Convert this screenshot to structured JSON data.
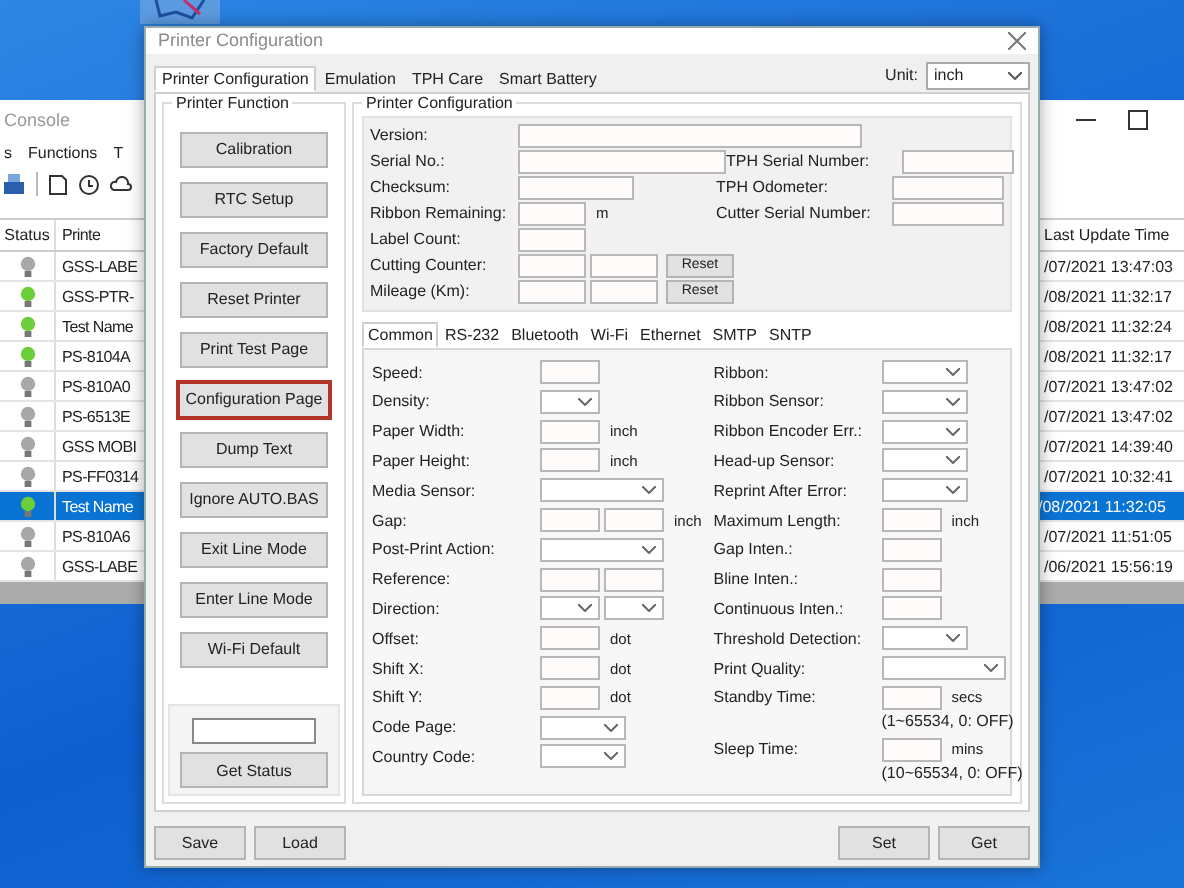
{
  "console": {
    "title": "Console",
    "menu": [
      "s",
      "Functions",
      "T"
    ],
    "columns": {
      "status": "Status",
      "column_2": "Printe",
      "last_update": "Last Update Time"
    },
    "rows": [
      {
        "online": false,
        "name": "GSS-LABE",
        "last_update": "/07/2021 13:47:03",
        "selected": false
      },
      {
        "online": true,
        "name": "GSS-PTR-",
        "last_update": "/08/2021 11:32:17",
        "selected": false
      },
      {
        "online": true,
        "name": "Test Name",
        "last_update": "/08/2021 11:32:24",
        "selected": false
      },
      {
        "online": true,
        "name": "PS-8104A",
        "last_update": "/08/2021 11:32:17",
        "selected": false
      },
      {
        "online": false,
        "name": "PS-810A0",
        "last_update": "/07/2021 13:47:02",
        "selected": false
      },
      {
        "online": false,
        "name": "PS-6513E",
        "last_update": "/07/2021 13:47:02",
        "selected": false
      },
      {
        "online": false,
        "name": "GSS MOBI",
        "last_update": "/07/2021 14:39:40",
        "selected": false
      },
      {
        "online": false,
        "name": "PS-FF0314",
        "last_update": "/07/2021 10:32:41",
        "selected": false
      },
      {
        "online": true,
        "name": "Test Name",
        "last_update": "/08/2021 11:32:05",
        "selected": true
      },
      {
        "online": false,
        "name": "PS-810A6",
        "last_update": "/07/2021 11:51:05",
        "selected": false
      },
      {
        "online": false,
        "name": "GSS-LABE",
        "last_update": "/06/2021 15:56:19",
        "selected": false
      }
    ]
  },
  "dialog": {
    "title": "Printer Configuration",
    "tabs": [
      {
        "label": "Printer Configuration",
        "selected": true
      },
      {
        "label": "Emulation",
        "selected": false
      },
      {
        "label": "TPH Care",
        "selected": false
      },
      {
        "label": "Smart Battery",
        "selected": false
      }
    ],
    "unit": {
      "label": "Unit:",
      "value": "inch"
    },
    "function_group": {
      "title": "Printer Function",
      "buttons": [
        {
          "label": "Calibration",
          "highlighted": false
        },
        {
          "label": "RTC Setup",
          "highlighted": false
        },
        {
          "label": "Factory Default",
          "highlighted": false
        },
        {
          "label": "Reset Printer",
          "highlighted": false
        },
        {
          "label": "Print Test Page",
          "highlighted": false
        },
        {
          "label": "Configuration Page",
          "highlighted": true
        },
        {
          "label": "Dump Text",
          "highlighted": false
        },
        {
          "label": "Ignore AUTO.BAS",
          "highlighted": false
        },
        {
          "label": "Exit Line Mode",
          "highlighted": false
        },
        {
          "label": "Enter Line Mode",
          "highlighted": false
        },
        {
          "label": "Wi-Fi Default",
          "highlighted": false
        }
      ],
      "status_button": "Get Status"
    },
    "config_group": {
      "title": "Printer Configuration",
      "info_rows": [
        {
          "label": "Version:",
          "fields": [
            {
              "kind": "long"
            }
          ]
        },
        {
          "label": "Serial No.:",
          "fields": [
            {
              "kind": "wide"
            }
          ],
          "right": "TPH Serial Number:"
        },
        {
          "label": "Checksum:",
          "fields": [
            {
              "kind": "medium"
            }
          ],
          "right": "TPH Odometer:"
        },
        {
          "label": "Ribbon Remaining:",
          "fields": [
            {
              "kind": "short"
            }
          ],
          "unit": "m",
          "right": "Cutter Serial Number:"
        },
        {
          "label": "Label Count:",
          "fields": [
            {
              "kind": "short"
            }
          ]
        },
        {
          "label": "Cutting Counter:",
          "fields": [
            {
              "kind": "short"
            },
            {
              "kind": "short"
            }
          ],
          "button": "Reset"
        },
        {
          "label": "Mileage (Km):",
          "fields": [
            {
              "kind": "short"
            },
            {
              "kind": "short"
            }
          ],
          "button": "Reset"
        }
      ],
      "tabs": [
        {
          "label": "Common",
          "selected": true
        },
        {
          "label": "RS-232",
          "selected": false
        },
        {
          "label": "Bluetooth",
          "selected": false
        },
        {
          "label": "Wi-Fi",
          "selected": false
        },
        {
          "label": "Ethernet",
          "selected": false
        },
        {
          "label": "SMTP",
          "selected": false
        },
        {
          "label": "SNTP",
          "selected": false
        }
      ],
      "common_left": [
        {
          "label": "Speed:",
          "fields": [
            {
              "kind": "text"
            }
          ]
        },
        {
          "label": "Density:",
          "fields": [
            {
              "kind": "select"
            }
          ]
        },
        {
          "label": "Paper Width:",
          "fields": [
            {
              "kind": "text"
            }
          ],
          "unit": "inch"
        },
        {
          "label": "Paper Height:",
          "fields": [
            {
              "kind": "text"
            }
          ],
          "unit": "inch"
        },
        {
          "label": "Media Sensor:",
          "fields": [
            {
              "kind": "select-wide"
            }
          ]
        },
        {
          "label": "Gap:",
          "fields": [
            {
              "kind": "text"
            },
            {
              "kind": "text"
            }
          ],
          "unit": "inch"
        },
        {
          "label": "Post-Print Action:",
          "fields": [
            {
              "kind": "select-wide"
            }
          ]
        },
        {
          "label": "Reference:",
          "fields": [
            {
              "kind": "text"
            },
            {
              "kind": "text"
            }
          ]
        },
        {
          "label": "Direction:",
          "fields": [
            {
              "kind": "select"
            },
            {
              "kind": "select"
            }
          ]
        },
        {
          "label": "Offset:",
          "fields": [
            {
              "kind": "text"
            }
          ],
          "unit": "dot"
        },
        {
          "label": "Shift X:",
          "fields": [
            {
              "kind": "text"
            }
          ],
          "unit": "dot"
        },
        {
          "label": "Shift Y:",
          "fields": [
            {
              "kind": "text"
            }
          ],
          "unit": "dot"
        },
        {
          "label": "Code Page:",
          "fields": [
            {
              "kind": "select-medium"
            }
          ]
        },
        {
          "label": "Country Code:",
          "fields": [
            {
              "kind": "select-medium"
            }
          ]
        }
      ],
      "common_right": [
        {
          "label": "Ribbon:",
          "fields": [
            {
              "kind": "select-medium"
            }
          ]
        },
        {
          "label": "Ribbon Sensor:",
          "fields": [
            {
              "kind": "select-medium"
            }
          ]
        },
        {
          "label": "Ribbon Encoder Err.:",
          "fields": [
            {
              "kind": "select-medium"
            }
          ]
        },
        {
          "label": "Head-up Sensor:",
          "fields": [
            {
              "kind": "select-medium"
            }
          ]
        },
        {
          "label": "Reprint After Error:",
          "fields": [
            {
              "kind": "select-medium"
            }
          ]
        },
        {
          "label": "Maximum Length:",
          "fields": [
            {
              "kind": "text"
            }
          ],
          "unit": "inch"
        },
        {
          "label": "Gap Inten.:",
          "fields": [
            {
              "kind": "text"
            }
          ]
        },
        {
          "label": "Bline Inten.:",
          "fields": [
            {
              "kind": "text"
            }
          ]
        },
        {
          "label": "Continuous Inten.:",
          "fields": [
            {
              "kind": "text"
            }
          ]
        },
        {
          "label": "Threshold Detection:",
          "fields": [
            {
              "kind": "select-medium"
            }
          ]
        },
        {
          "label": "Print Quality:",
          "fields": [
            {
              "kind": "select-wide"
            }
          ]
        },
        {
          "label": "Standby Time:",
          "fields": [
            {
              "kind": "text"
            }
          ],
          "unit": "secs",
          "note": "(1~65534, 0: OFF)"
        },
        {
          "label": "Sleep Time:",
          "fields": [
            {
              "kind": "text"
            }
          ],
          "unit": "mins",
          "note": "(10~65534, 0: OFF)"
        }
      ]
    },
    "buttons_left": [
      "Save",
      "Load"
    ],
    "buttons_right": [
      "Set",
      "Get"
    ]
  }
}
